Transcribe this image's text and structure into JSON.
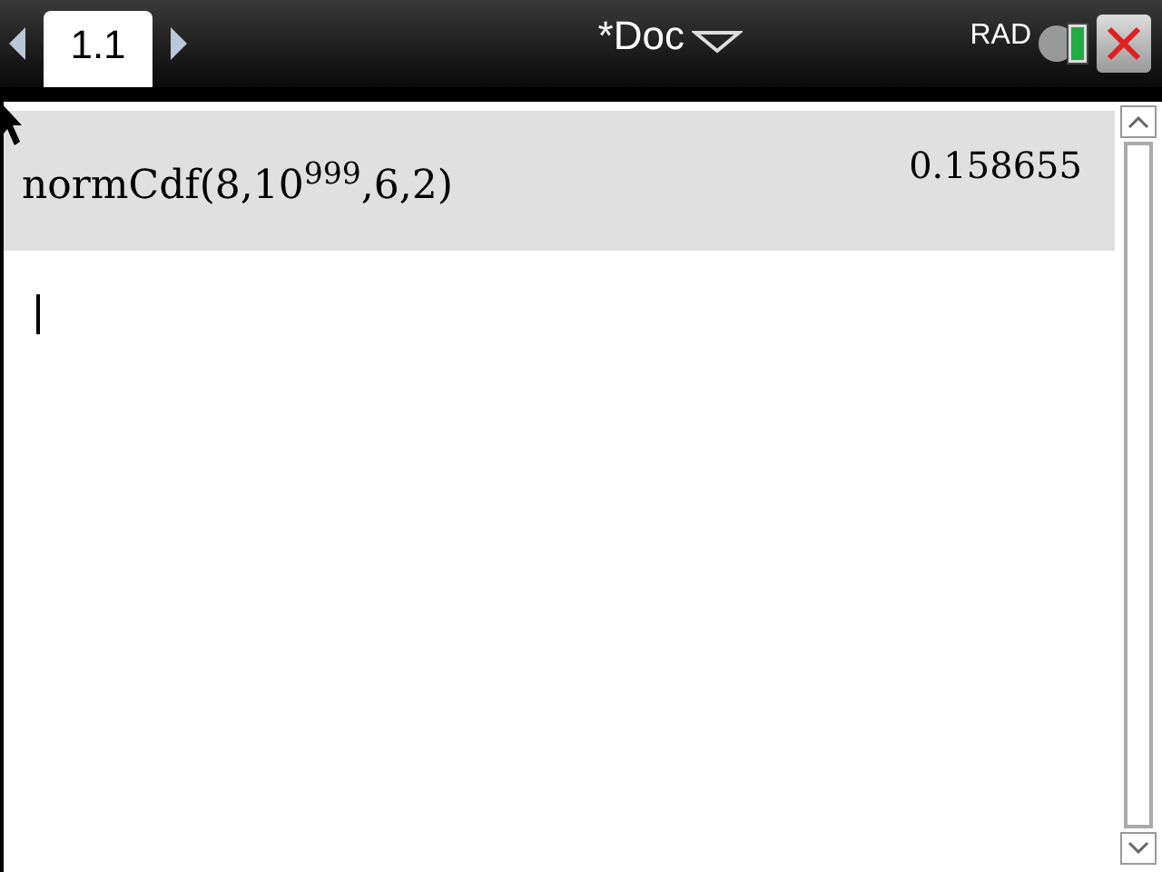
{
  "top_bar": {
    "tabs": [
      {
        "label": "1.1",
        "selected": true
      }
    ],
    "document_title": "*Doc",
    "angle_mode": "RAD"
  },
  "history": [
    {
      "input": "normCdf(8,10$^{999}$,6,2)",
      "result": "0.158655",
      "selected": true
    }
  ]
}
